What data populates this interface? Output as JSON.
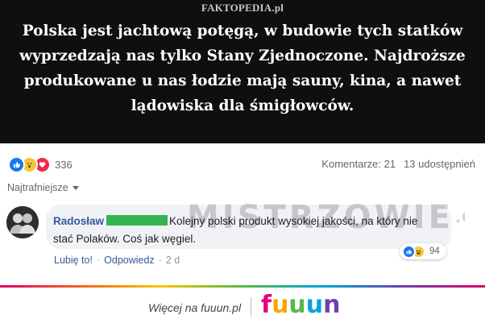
{
  "post": {
    "watermark": "FAKTOPEDIA.pl",
    "quote_lines": [
      "Polska jest jachtową potęgą, w budowie tych statków",
      "wyprzedzają nas tylko Stany Zjednoczone. Najdroższe",
      "produkowane u nas łodzie mają sauny, kina, a nawet",
      "lądowiska dla śmigłowców."
    ]
  },
  "reactions": {
    "icons": [
      "like-icon",
      "wow-icon",
      "love-icon"
    ],
    "count": "336",
    "comments": "Komentarze: 21",
    "shares": "13 udostępnień"
  },
  "sort": {
    "label": "Najtrafniejsze"
  },
  "comment": {
    "author": "Radosław",
    "text": "Kolejny polski produkt wysokiej jakości, na który nie stać Polaków. Coś jak węgiel.",
    "reaction_icons": [
      "like-icon",
      "haha-icon"
    ],
    "reaction_count": "94",
    "like_label": "Lubię to!",
    "reply_label": "Odpowiedz",
    "separator": "·",
    "time": "2 d",
    "redaction_color": "#35b552"
  },
  "overlay": {
    "site_watermark": "MISTRZOWIE",
    "site_watermark_tld": ".ORG"
  },
  "footer": {
    "text": "Więcej na fuuun.pl",
    "brand": [
      "f",
      "u",
      "u",
      "u",
      "n"
    ],
    "brand_colors": [
      "#e4007d",
      "#f7a600",
      "#55b948",
      "#00a5d8",
      "#6f3fa9"
    ]
  }
}
